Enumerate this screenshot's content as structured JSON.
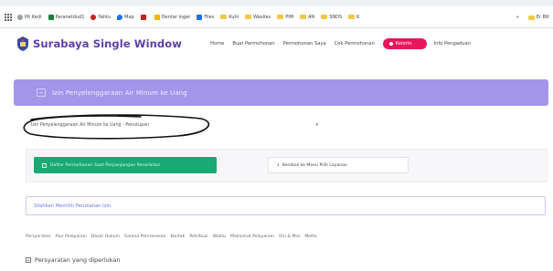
{
  "browser": {
    "bookmarks": [
      {
        "label": "Pit Kedi",
        "icon": "globe-icon",
        "color": "#9aa0a6"
      },
      {
        "label": "Paranetdud1",
        "icon": "green-square-icon",
        "color": "#188038"
      },
      {
        "label": "Yahtu",
        "icon": "red-dot-icon",
        "color": "#c5221f"
      },
      {
        "label": "Map",
        "icon": "map-pin-icon",
        "color": "#1a73e8"
      },
      {
        "label": "",
        "icon": "red-x-icon",
        "color": "#c5221f"
      },
      {
        "label": "Dentar inger",
        "icon": "drive-icon",
        "color": "#f4b400"
      },
      {
        "label": "Files",
        "icon": "star-icon",
        "color": "#1a73e8"
      },
      {
        "label": "Kuhi",
        "icon": "folder-icon",
        "color": "#f3c84a"
      },
      {
        "label": "Waxiles",
        "icon": "folder-icon",
        "color": "#f3c84a"
      },
      {
        "label": "PIM",
        "icon": "folder-icon",
        "color": "#f3c84a"
      },
      {
        "label": "AN",
        "icon": "folder-icon",
        "color": "#f3c84a"
      },
      {
        "label": "SNDS",
        "icon": "folder-icon",
        "color": "#f3c84a"
      },
      {
        "label": "K",
        "icon": "folder-icon",
        "color": "#f3c84a"
      }
    ],
    "overflow_label": "»",
    "other_bookmarks": "Er Btt"
  },
  "header": {
    "brand": "Surabaya Single Window",
    "brand_color": "#5d3fa8",
    "nav": {
      "home": "Home",
      "buat_permohonan": "Buat Permohonan",
      "permohonan_saya": "Permohonan Saya",
      "cek_permohonan": "Cek Permohonan",
      "active": "Kelorin",
      "info": "Info Pengaduan"
    },
    "accent_color": "#e8175d"
  },
  "banner": {
    "title": "Izin Penyelenggaraan Air Minum ke Uang",
    "color": "#a395ea"
  },
  "select": {
    "value": "Izin Penyelenggaraan Air Minum ke Uang - Penutupan",
    "caret": "▾"
  },
  "actions": {
    "primary_label": "Daftar Permohonan Saat Perpanjangan Penerbitan",
    "primary_color": "#19a974",
    "secondary_label": "Kembali ke Menu Pilih Layanan",
    "secondary_chevron": "‹"
  },
  "alert": {
    "text": "Silahkan Memilih Perubahan Izin",
    "color": "#6a78e4"
  },
  "tabs": [
    "Persyaratan",
    "Alur Pelayanan",
    "Dasar Hukum",
    "Sarana Pemrosesan",
    "Kontak",
    "Retribusi",
    "Waktu",
    "Maklumat Pelayanan",
    "Visi & Misi",
    "Motto"
  ],
  "section": {
    "title": "Persyaratan yang diperlukan"
  }
}
